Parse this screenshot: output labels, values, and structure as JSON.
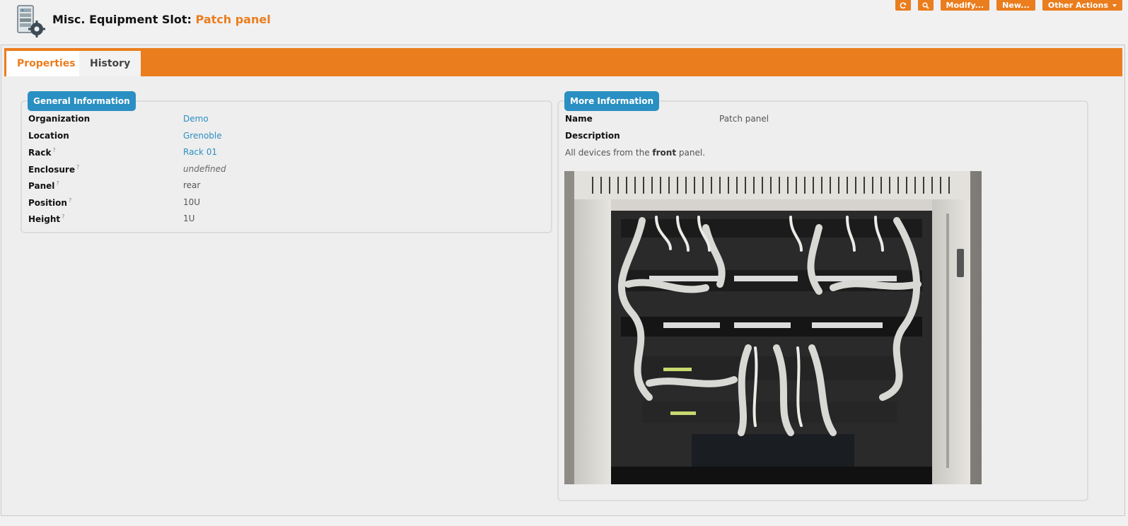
{
  "header": {
    "title_prefix": "Misc. Equipment Slot:",
    "title_name": "Patch panel",
    "actions": {
      "refresh_icon": "refresh-icon",
      "search_icon": "search-icon",
      "modify": "Modify...",
      "new": "New...",
      "other": "Other Actions"
    }
  },
  "tabs": [
    {
      "label": "Properties",
      "active": true
    },
    {
      "label": "History",
      "active": false
    }
  ],
  "general": {
    "legend": "General Information",
    "rows": [
      {
        "label": "Organization",
        "help": false,
        "value": "Demo"
      },
      {
        "label": "Location",
        "help": false,
        "value": "Grenoble"
      },
      {
        "label": "Rack",
        "help": true,
        "value": "Rack 01"
      },
      {
        "label": "Enclosure",
        "help": true,
        "value": "undefined"
      },
      {
        "label": "Panel",
        "help": true,
        "value": "rear"
      },
      {
        "label": "Position",
        "help": true,
        "value": "10U"
      },
      {
        "label": "Height",
        "help": true,
        "value": "1U"
      }
    ],
    "help_mark": "?"
  },
  "more": {
    "legend": "More Information",
    "name_label": "Name",
    "name_value": "Patch panel",
    "description_label": "Description",
    "description_pre": "All devices from the ",
    "description_bold": "front",
    "description_post": " panel."
  },
  "colors": {
    "accent": "#ea7d1e",
    "legend": "#2a8fc2"
  }
}
